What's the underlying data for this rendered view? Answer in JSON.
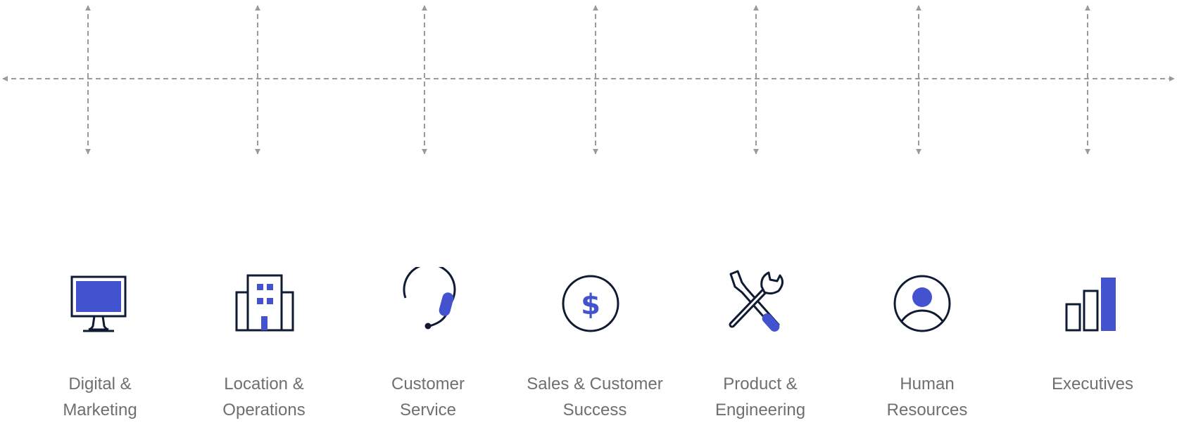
{
  "colors": {
    "arrow": "#9a9a9a",
    "icon_outline": "#0f1b33",
    "icon_accent": "#4352cf",
    "label": "#6f6f6f",
    "background": "#ffffff"
  },
  "departments": [
    {
      "icon": "monitor-icon",
      "label_lines": [
        "Digital &",
        "Marketing"
      ]
    },
    {
      "icon": "building-icon",
      "label_lines": [
        "Location &",
        "Operations"
      ]
    },
    {
      "icon": "headset-icon",
      "label_lines": [
        "Customer",
        "Service"
      ]
    },
    {
      "icon": "dollar-coin-icon",
      "label_lines": [
        "Sales & Customer",
        "Success"
      ]
    },
    {
      "icon": "tools-icon",
      "label_lines": [
        "Product &",
        "Engineering"
      ]
    },
    {
      "icon": "user-icon",
      "label_lines": [
        "Human",
        "Resources"
      ]
    },
    {
      "icon": "bar-chart-icon",
      "label_lines": [
        "Executives"
      ]
    }
  ]
}
